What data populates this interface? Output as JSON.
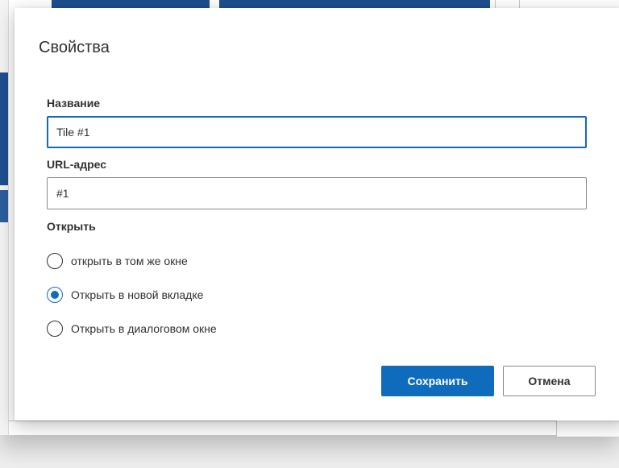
{
  "dialog": {
    "title": "Свойства",
    "name_label": "Название",
    "name_value": "Tile #1",
    "url_label": "URL-адрес",
    "url_value": "#1",
    "open_label": "Открыть",
    "open_options": [
      {
        "label": "открыть в том же окне",
        "checked": false
      },
      {
        "label": "Открыть в новой вкладке",
        "checked": true
      },
      {
        "label": "Открыть в диалоговом окне",
        "checked": false
      }
    ],
    "save_label": "Сохранить",
    "cancel_label": "Отмена"
  },
  "colors": {
    "accent": "#0f6cbd",
    "background_tile": "#1e4f8f",
    "text": "#323130",
    "border": "#8a8886"
  },
  "icons": [
    "radio-button-icon"
  ]
}
